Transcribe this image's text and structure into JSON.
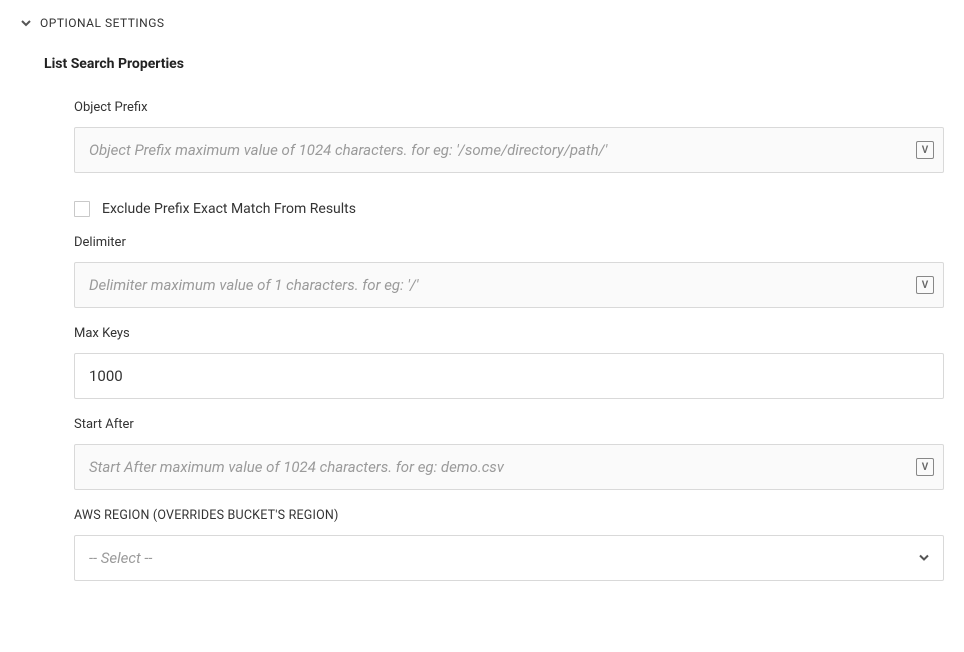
{
  "section": {
    "title": "OPTIONAL SETTINGS"
  },
  "subsection": {
    "title": "List Search Properties"
  },
  "fields": {
    "objectPrefix": {
      "label": "Object Prefix",
      "placeholder": "Object Prefix maximum value of 1024 characters. for eg: '/some/directory/path/'",
      "value": "",
      "badge": "V"
    },
    "excludePrefix": {
      "label": "Exclude Prefix Exact Match From Results",
      "checked": false
    },
    "delimiter": {
      "label": "Delimiter",
      "placeholder": "Delimiter maximum value of 1 characters. for eg: '/'",
      "value": "",
      "badge": "V"
    },
    "maxKeys": {
      "label": "Max Keys",
      "value": "1000"
    },
    "startAfter": {
      "label": "Start After",
      "placeholder": "Start After maximum value of 1024 characters. for eg: demo.csv",
      "value": "",
      "badge": "V"
    },
    "awsRegion": {
      "label": "AWS REGION (OVERRIDES BUCKET'S REGION)",
      "placeholder": "-- Select --"
    }
  }
}
